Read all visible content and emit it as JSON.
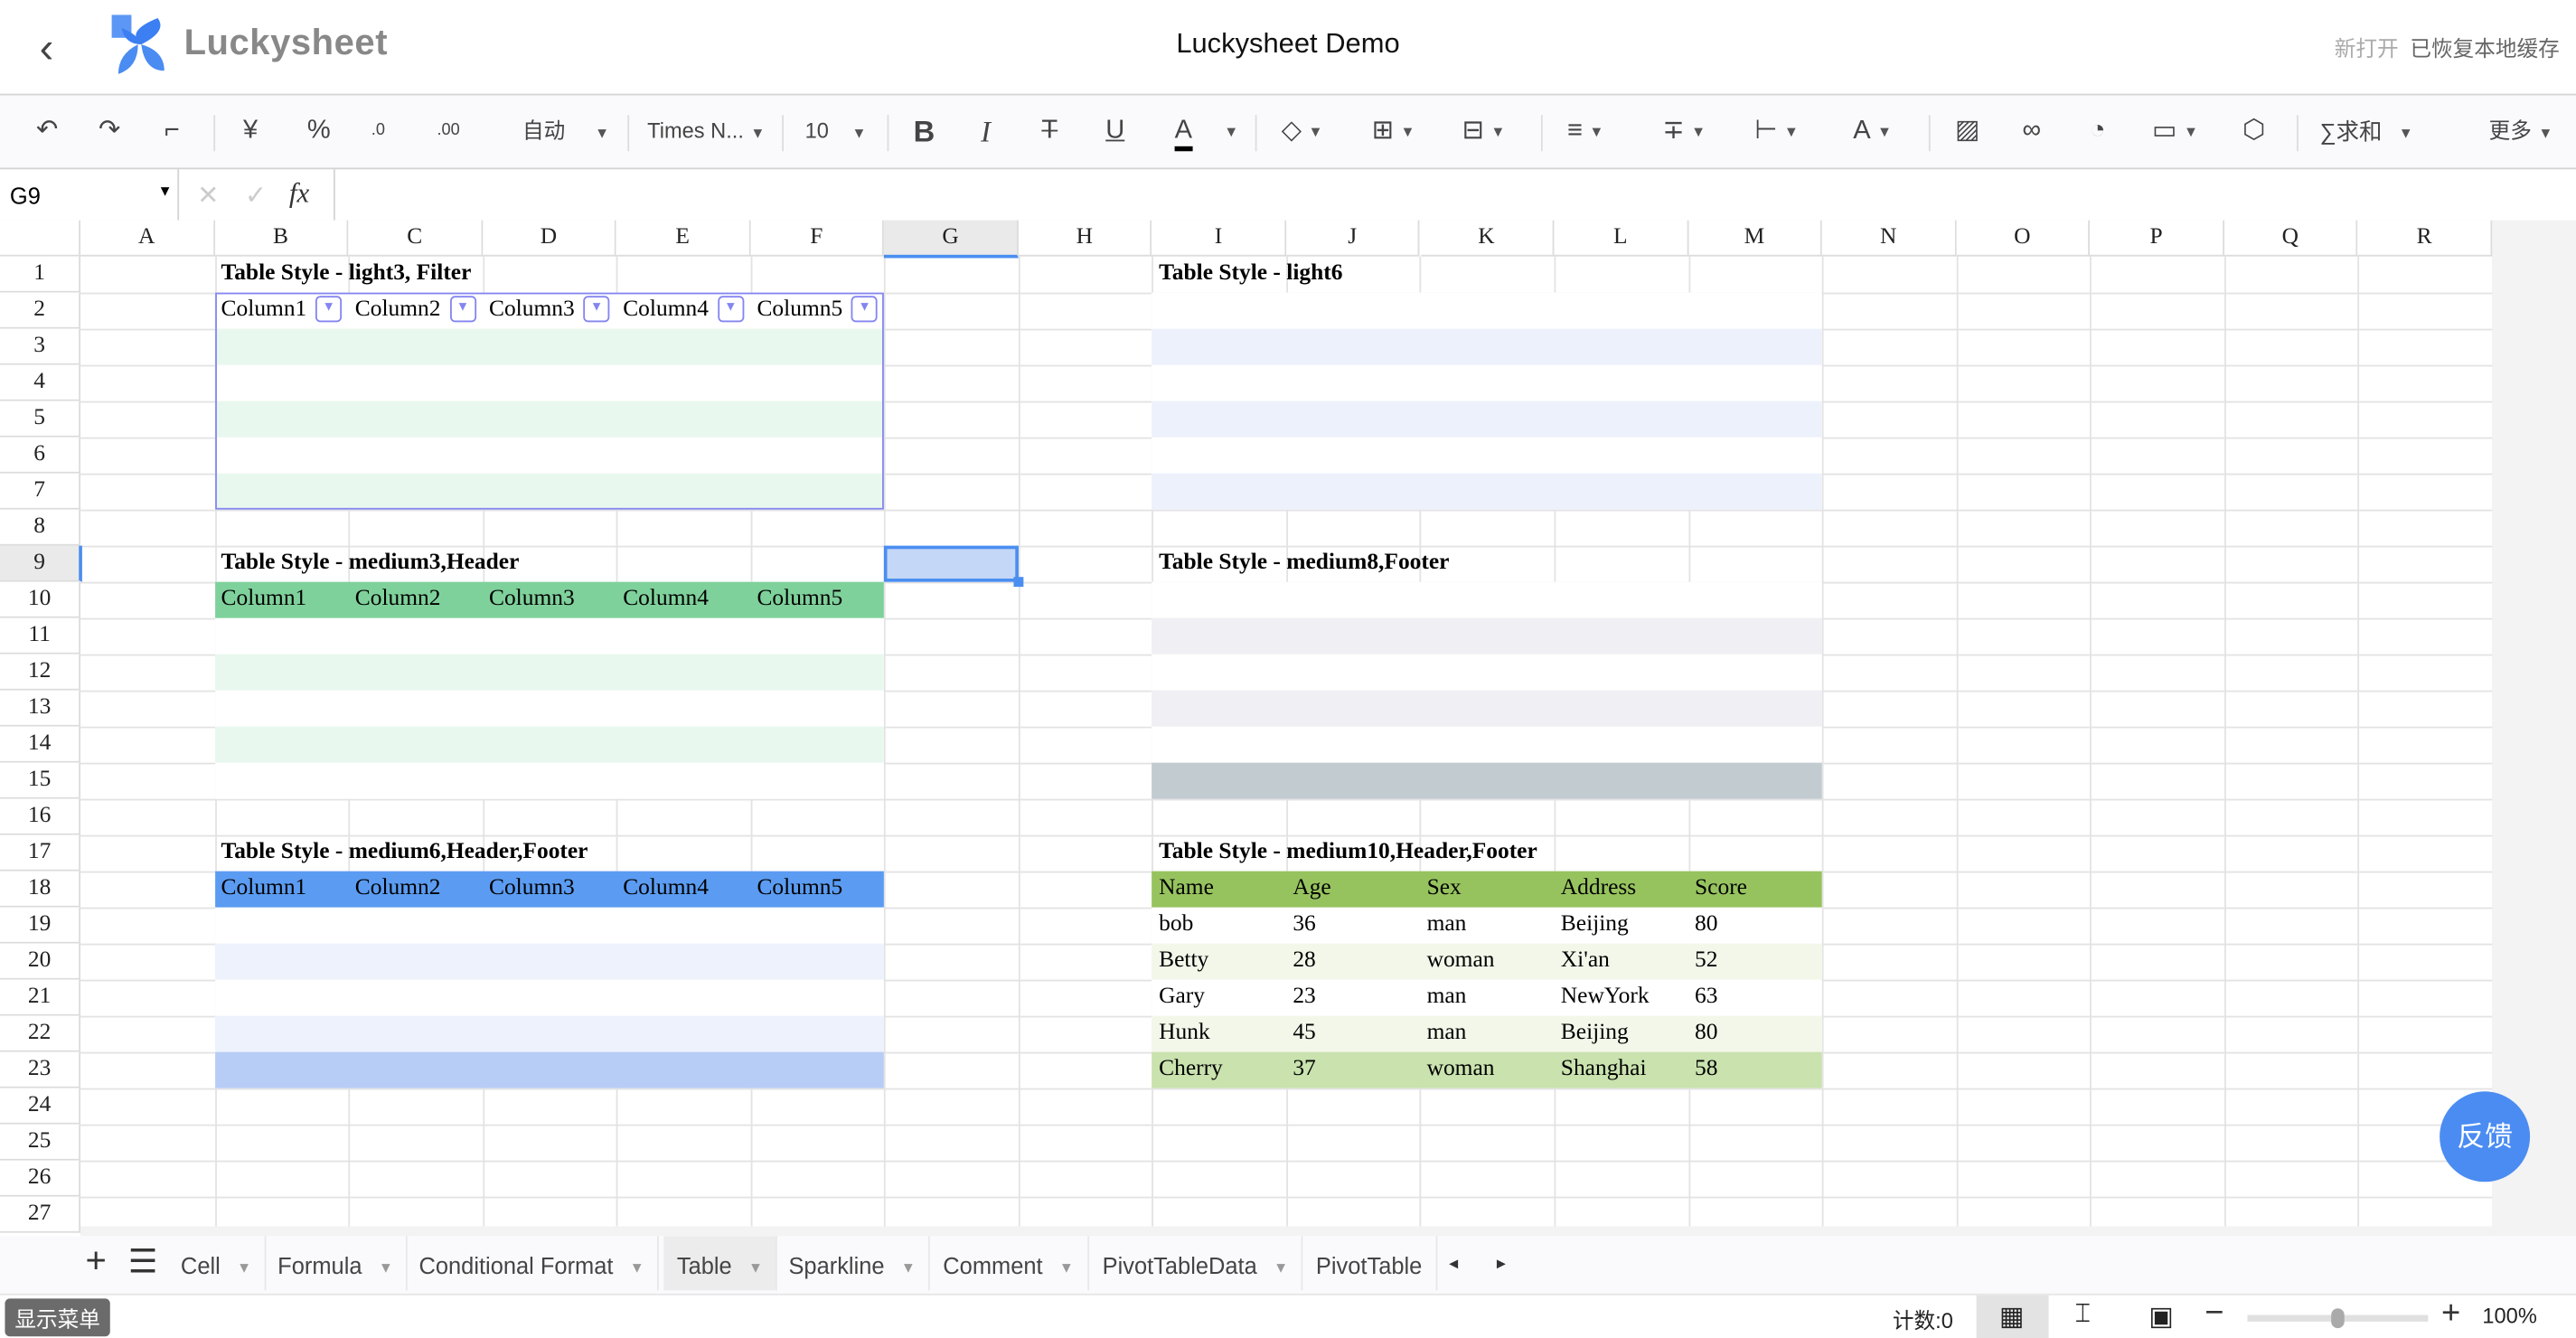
{
  "header": {
    "back_icon": "chevron-left-icon",
    "brand": "Luckysheet",
    "title": "Luckysheet Demo",
    "status_open": "新打开",
    "status_cache": "已恢复本地缓存"
  },
  "toolbar": {
    "number_format": "自动",
    "font": "Times N...",
    "font_size": "10",
    "sum": "求和",
    "more": "更多"
  },
  "formula_bar": {
    "cell_ref": "G9",
    "fx": "fx",
    "value": ""
  },
  "columns": [
    "A",
    "B",
    "C",
    "D",
    "E",
    "F",
    "G",
    "H",
    "I",
    "J",
    "K",
    "L",
    "M",
    "N",
    "O",
    "P",
    "Q",
    "R"
  ],
  "rows": [
    "1",
    "2",
    "3",
    "4",
    "5",
    "6",
    "7",
    "8",
    "9",
    "10",
    "11",
    "12",
    "13",
    "14",
    "15",
    "16",
    "17",
    "18",
    "19",
    "20",
    "21",
    "22",
    "23",
    "24",
    "25",
    "26",
    "27"
  ],
  "selection": {
    "cell": "G9",
    "fill": "#c4d7f6",
    "border": "#4a8ef0"
  },
  "tables": [
    {
      "range": "B2:F7",
      "border": "#8485f0",
      "filter": true,
      "stripes": [
        {
          "range": "B3:F3",
          "color": "#e9f8ee"
        },
        {
          "range": "B5:F5",
          "color": "#e9f8ee"
        },
        {
          "range": "B7:F7",
          "color": "#e9f8ee"
        }
      ]
    },
    {
      "range": "B10:F15",
      "stripes": [
        {
          "range": "B10:F10",
          "color": "#7fd19b"
        },
        {
          "range": "B12:F12",
          "color": "#e9f8ee"
        },
        {
          "range": "B14:F14",
          "color": "#e9f8ee"
        }
      ]
    },
    {
      "range": "B18:F23",
      "stripes": [
        {
          "range": "B18:F18",
          "color": "#5b9cf2"
        },
        {
          "range": "B20:F20",
          "color": "#edf2fc"
        },
        {
          "range": "B22:F22",
          "color": "#edf2fc"
        },
        {
          "range": "B23:F23",
          "color": "#b8cdf5"
        }
      ]
    },
    {
      "range": "I2:M7",
      "stripes": [
        {
          "range": "I3:M3",
          "color": "#edf1fc"
        },
        {
          "range": "I5:M5",
          "color": "#edf1fc"
        },
        {
          "range": "I7:M7",
          "color": "#edf1fc"
        }
      ]
    },
    {
      "range": "I10:M15",
      "stripes": [
        {
          "range": "I11:M11",
          "color": "#efeff4"
        },
        {
          "range": "I13:M13",
          "color": "#efeff4"
        },
        {
          "range": "I15:M15",
          "color": "#c1cbd0"
        }
      ]
    },
    {
      "range": "I18:M23",
      "stripes": [
        {
          "range": "I18:M18",
          "color": "#97c35f"
        },
        {
          "range": "I20:M20",
          "color": "#f2f7ea"
        },
        {
          "range": "I22:M22",
          "color": "#f2f7ea"
        },
        {
          "range": "I23:M23",
          "color": "#c9e2ae"
        }
      ]
    }
  ],
  "cells": [
    {
      "ref": "B1",
      "text": "Table Style - light3, Filter",
      "bold": true
    },
    {
      "ref": "B2",
      "text": "Column1"
    },
    {
      "ref": "C2",
      "text": "Column2"
    },
    {
      "ref": "D2",
      "text": "Column3"
    },
    {
      "ref": "E2",
      "text": "Column4"
    },
    {
      "ref": "F2",
      "text": "Column5"
    },
    {
      "ref": "B9",
      "text": "Table Style - medium3,Header",
      "bold": true
    },
    {
      "ref": "B10",
      "text": "Column1"
    },
    {
      "ref": "C10",
      "text": "Column2"
    },
    {
      "ref": "D10",
      "text": "Column3"
    },
    {
      "ref": "E10",
      "text": "Column4"
    },
    {
      "ref": "F10",
      "text": "Column5"
    },
    {
      "ref": "B17",
      "text": "Table Style - medium6,Header,Footer",
      "bold": true
    },
    {
      "ref": "B18",
      "text": "Column1"
    },
    {
      "ref": "C18",
      "text": "Column2"
    },
    {
      "ref": "D18",
      "text": "Column3"
    },
    {
      "ref": "E18",
      "text": "Column4"
    },
    {
      "ref": "F18",
      "text": "Column5"
    },
    {
      "ref": "I1",
      "text": "Table Style - light6",
      "bold": true
    },
    {
      "ref": "I9",
      "text": "Table Style - medium8,Footer",
      "bold": true
    },
    {
      "ref": "I17",
      "text": "Table Style - medium10,Header,Footer",
      "bold": true
    },
    {
      "ref": "I18",
      "text": "Name"
    },
    {
      "ref": "J18",
      "text": "Age"
    },
    {
      "ref": "K18",
      "text": "Sex"
    },
    {
      "ref": "L18",
      "text": "Address"
    },
    {
      "ref": "M18",
      "text": "Score"
    },
    {
      "ref": "I19",
      "text": "bob"
    },
    {
      "ref": "J19",
      "text": "36"
    },
    {
      "ref": "K19",
      "text": "man"
    },
    {
      "ref": "L19",
      "text": "Beijing"
    },
    {
      "ref": "M19",
      "text": "80"
    },
    {
      "ref": "I20",
      "text": "Betty"
    },
    {
      "ref": "J20",
      "text": "28"
    },
    {
      "ref": "K20",
      "text": "woman"
    },
    {
      "ref": "L20",
      "text": "Xi'an"
    },
    {
      "ref": "M20",
      "text": "52"
    },
    {
      "ref": "I21",
      "text": "Gary"
    },
    {
      "ref": "J21",
      "text": "23"
    },
    {
      "ref": "K21",
      "text": "man"
    },
    {
      "ref": "L21",
      "text": "NewYork"
    },
    {
      "ref": "M21",
      "text": "63"
    },
    {
      "ref": "I22",
      "text": "Hunk"
    },
    {
      "ref": "J22",
      "text": "45"
    },
    {
      "ref": "K22",
      "text": "man"
    },
    {
      "ref": "L22",
      "text": "Beijing"
    },
    {
      "ref": "M22",
      "text": "80"
    },
    {
      "ref": "I23",
      "text": "Cherry"
    },
    {
      "ref": "J23",
      "text": "37"
    },
    {
      "ref": "K23",
      "text": "woman"
    },
    {
      "ref": "L23",
      "text": "Shanghai"
    },
    {
      "ref": "M23",
      "text": "58"
    }
  ],
  "sheet_tabs": [
    {
      "label": "Cell"
    },
    {
      "label": "Formula"
    },
    {
      "label": "Conditional Format"
    },
    {
      "label": "Table",
      "active": true
    },
    {
      "label": "Sparkline"
    },
    {
      "label": "Comment"
    },
    {
      "label": "PivotTableData"
    },
    {
      "label": "PivotTable"
    }
  ],
  "status_bar": {
    "show_menu": "显示菜单",
    "count": "计数:0",
    "zoom": "100%",
    "zoom_level": 100
  },
  "feedback": "反馈",
  "colors": {
    "brand": "#4b8cf2",
    "accent": "#4a8ef0"
  }
}
